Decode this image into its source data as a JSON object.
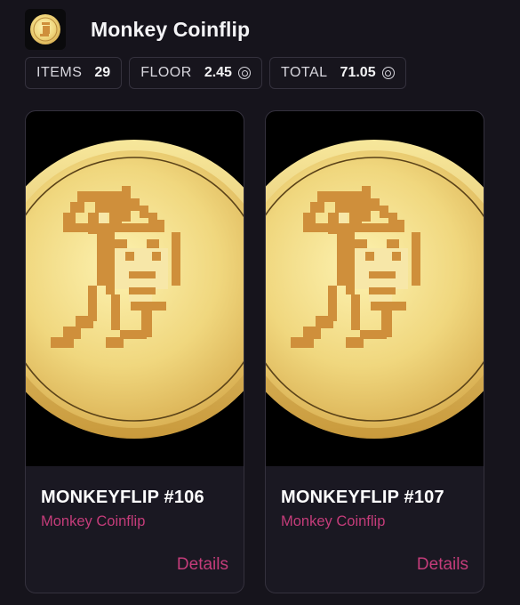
{
  "header": {
    "title": "Monkey Coinflip",
    "logo_icon": "coin-logo-icon"
  },
  "stats": [
    {
      "label": "ITEMS",
      "value": "29",
      "currency_icon": null
    },
    {
      "label": "FLOOR",
      "value": "2.45",
      "currency_icon": "sol-currency-icon"
    },
    {
      "label": "TOTAL",
      "value": "71.05",
      "currency_icon": "sol-currency-icon"
    }
  ],
  "cards": [
    {
      "name": "MONKEYFLIP #106",
      "collection": "Monkey Coinflip",
      "action": "Details",
      "image_icon": "monkey-coin-image"
    },
    {
      "name": "MONKEYFLIP #107",
      "collection": "Monkey Coinflip",
      "action": "Details",
      "image_icon": "monkey-coin-image"
    }
  ],
  "colors": {
    "background": "#16141c",
    "accent": "#c43c7a",
    "border": "#34313d",
    "coin_gold": "#f0dc88"
  }
}
